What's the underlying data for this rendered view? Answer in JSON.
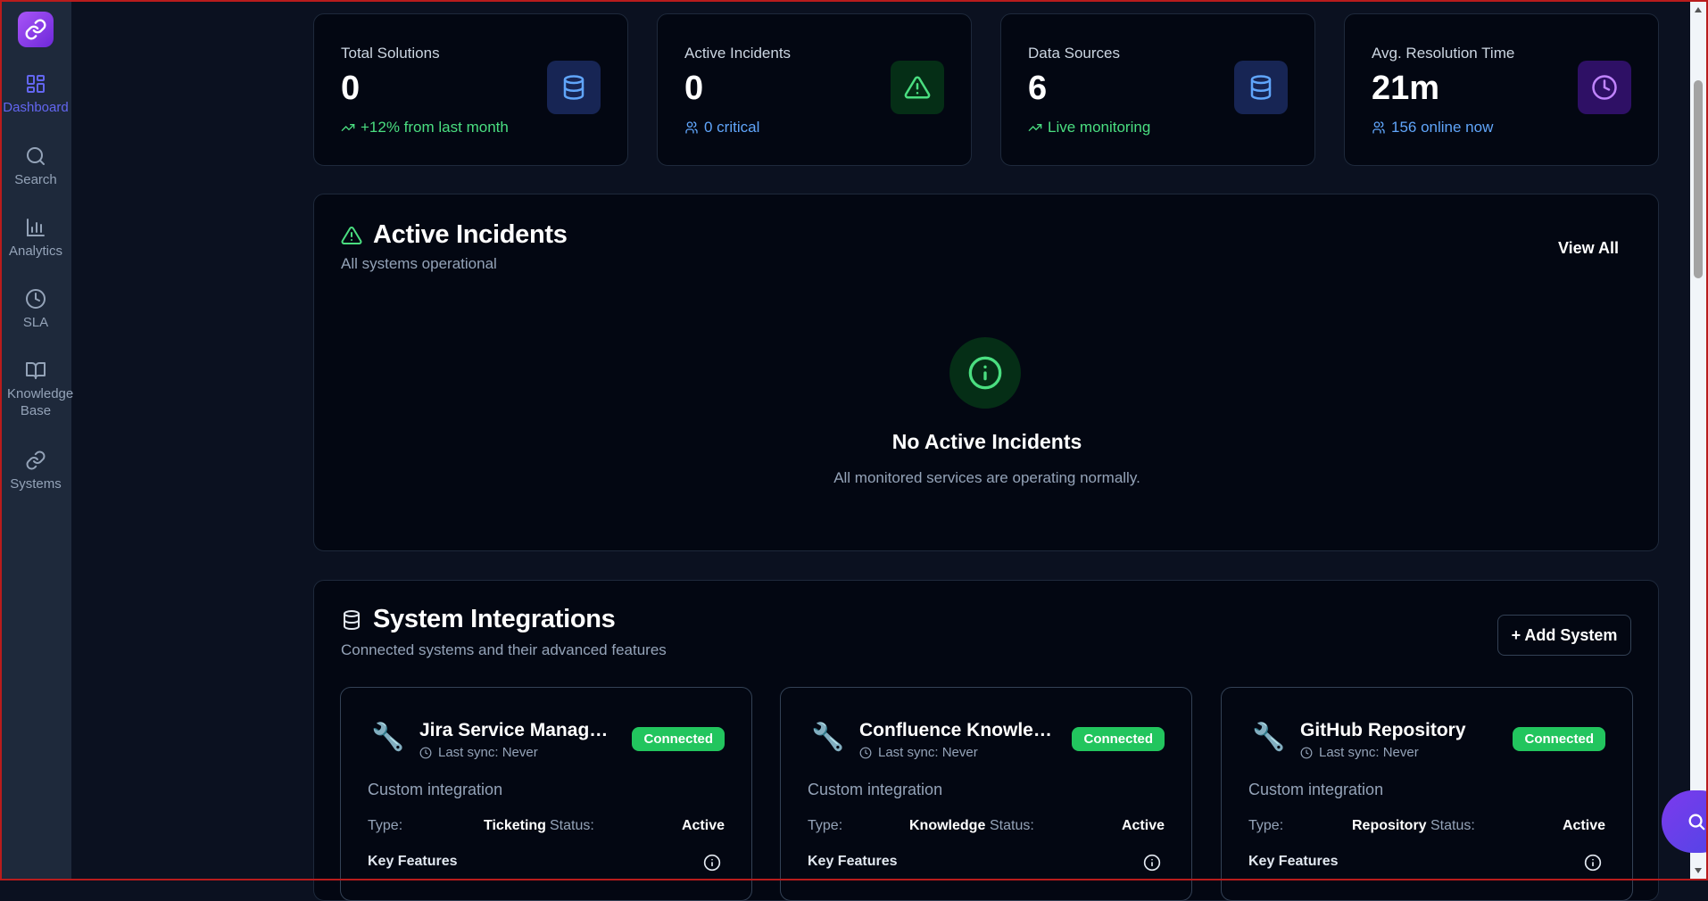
{
  "sidebar": {
    "items": [
      {
        "label": "Dashboard",
        "icon": "grid-icon"
      },
      {
        "label": "Search",
        "icon": "search-icon"
      },
      {
        "label": "Analytics",
        "icon": "bar-chart-icon"
      },
      {
        "label": "SLA",
        "icon": "clock-icon"
      },
      {
        "label": "Knowledge Base",
        "icon": "book-icon"
      },
      {
        "label": "Systems",
        "icon": "link-icon"
      }
    ]
  },
  "stats": [
    {
      "label": "Total Solutions",
      "value": "0",
      "sub": "+12% from last month",
      "sub_color": "#4ade80",
      "icon": "database-icon"
    },
    {
      "label": "Active Incidents",
      "value": "0",
      "sub": "0 critical",
      "sub_color": "#60a5fa",
      "icon": "alert-triangle-icon"
    },
    {
      "label": "Data Sources",
      "value": "6",
      "sub": "Live monitoring",
      "sub_color": "#4ade80",
      "icon": "database-icon"
    },
    {
      "label": "Avg. Resolution Time",
      "value": "21m",
      "sub": "156 online now",
      "sub_color": "#60a5fa",
      "icon": "clock-icon"
    }
  ],
  "incidents": {
    "title": "Active Incidents",
    "subtitle": "All systems operational",
    "view_all": "View All",
    "empty_title": "No Active Incidents",
    "empty_text": "All monitored services are operating normally."
  },
  "integrations": {
    "title": "System Integrations",
    "subtitle": "Connected systems and their advanced features",
    "add_button": "+ Add System",
    "cards": [
      {
        "name": "Jira Service Management",
        "sync": "Last sync: Never",
        "status_badge": "Connected",
        "desc": "Custom integration",
        "type_label": "Type:",
        "type": "Ticketing",
        "status_label": "Status:",
        "status": "Active",
        "features": "Key Features"
      },
      {
        "name": "Confluence Knowledge Base",
        "sync": "Last sync: Never",
        "status_badge": "Connected",
        "desc": "Custom integration",
        "type_label": "Type:",
        "type": "Knowledge",
        "status_label": "Status:",
        "status": "Active",
        "features": "Key Features"
      },
      {
        "name": "GitHub Repository",
        "sync": "Last sync: Never",
        "status_badge": "Connected",
        "desc": "Custom integration",
        "type_label": "Type:",
        "type": "Repository",
        "status_label": "Status:",
        "status": "Active",
        "features": "Key Features"
      }
    ]
  },
  "colors": {
    "accent": "#6366f1",
    "success": "#22c55e",
    "background": "#0b1120",
    "card": "#030712"
  }
}
